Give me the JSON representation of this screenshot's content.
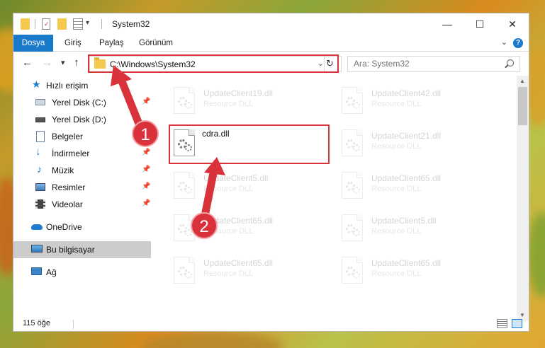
{
  "window": {
    "title": "System32",
    "minimize_glyph": "—",
    "maximize_glyph": "☐",
    "close_glyph": "✕"
  },
  "ribbon": {
    "tabs": [
      {
        "label": "Dosya",
        "active": true
      },
      {
        "label": "Giriş",
        "active": false
      },
      {
        "label": "Paylaş",
        "active": false
      },
      {
        "label": "Görünüm",
        "active": false
      }
    ],
    "help_glyph": "?"
  },
  "nav": {
    "back_glyph": "←",
    "forward_glyph": "→",
    "recent_glyph": "▾",
    "up_glyph": "↑",
    "refresh_glyph": "↻"
  },
  "address": {
    "path": "C:\\Windows\\System32"
  },
  "search": {
    "placeholder": "Ara: System32"
  },
  "sidebar": {
    "items": [
      {
        "label": "Hızlı erişim",
        "icon": "star-icon"
      },
      {
        "label": "Yerel Disk (C:)",
        "icon": "drive-icon",
        "pinned": true
      },
      {
        "label": "Yerel Disk (D:)",
        "icon": "drive-icon"
      },
      {
        "label": "Belgeler",
        "icon": "documents-icon"
      },
      {
        "label": "İndirmeler",
        "icon": "download-icon",
        "pinned": true
      },
      {
        "label": "Müzik",
        "icon": "music-icon",
        "pinned": true
      },
      {
        "label": "Resimler",
        "icon": "pictures-icon",
        "pinned": true
      },
      {
        "label": "Videolar",
        "icon": "video-icon",
        "pinned": true
      },
      {
        "label": "OneDrive",
        "icon": "cloud-icon"
      },
      {
        "label": "Bu bilgisayar",
        "icon": "computer-icon",
        "selected": true
      },
      {
        "label": "Ağ",
        "icon": "network-icon"
      }
    ]
  },
  "files": [
    {
      "name": "UpdateClient19.dll",
      "type": "Resource DLL",
      "faded": true
    },
    {
      "name": "UpdateClient42.dll",
      "type": "Resource DLL",
      "faded": true
    },
    {
      "name": "cdra.dll",
      "type": "",
      "faded": false
    },
    {
      "name": "UpdateClient21.dll",
      "type": "Resource DLL",
      "faded": true
    },
    {
      "name": "UpdateClient5.dll",
      "type": "Resource DLL",
      "faded": true
    },
    {
      "name": "UpdateClient65.dll",
      "type": "Resource DLL",
      "faded": true
    },
    {
      "name": "UpdateClient65.dll",
      "type": "Resource DLL",
      "faded": true
    },
    {
      "name": "UpdateClient5.dll",
      "type": "Resource DLL",
      "faded": true
    },
    {
      "name": "UpdateClient65.dll",
      "type": "Resource DLL",
      "faded": true
    },
    {
      "name": "UpdateClient65.dll",
      "type": "Resource DLL",
      "faded": true
    }
  ],
  "status": {
    "item_count": "115 öğe"
  },
  "annotations": {
    "step1": "1",
    "step2": "2",
    "color": "#d9323b"
  }
}
